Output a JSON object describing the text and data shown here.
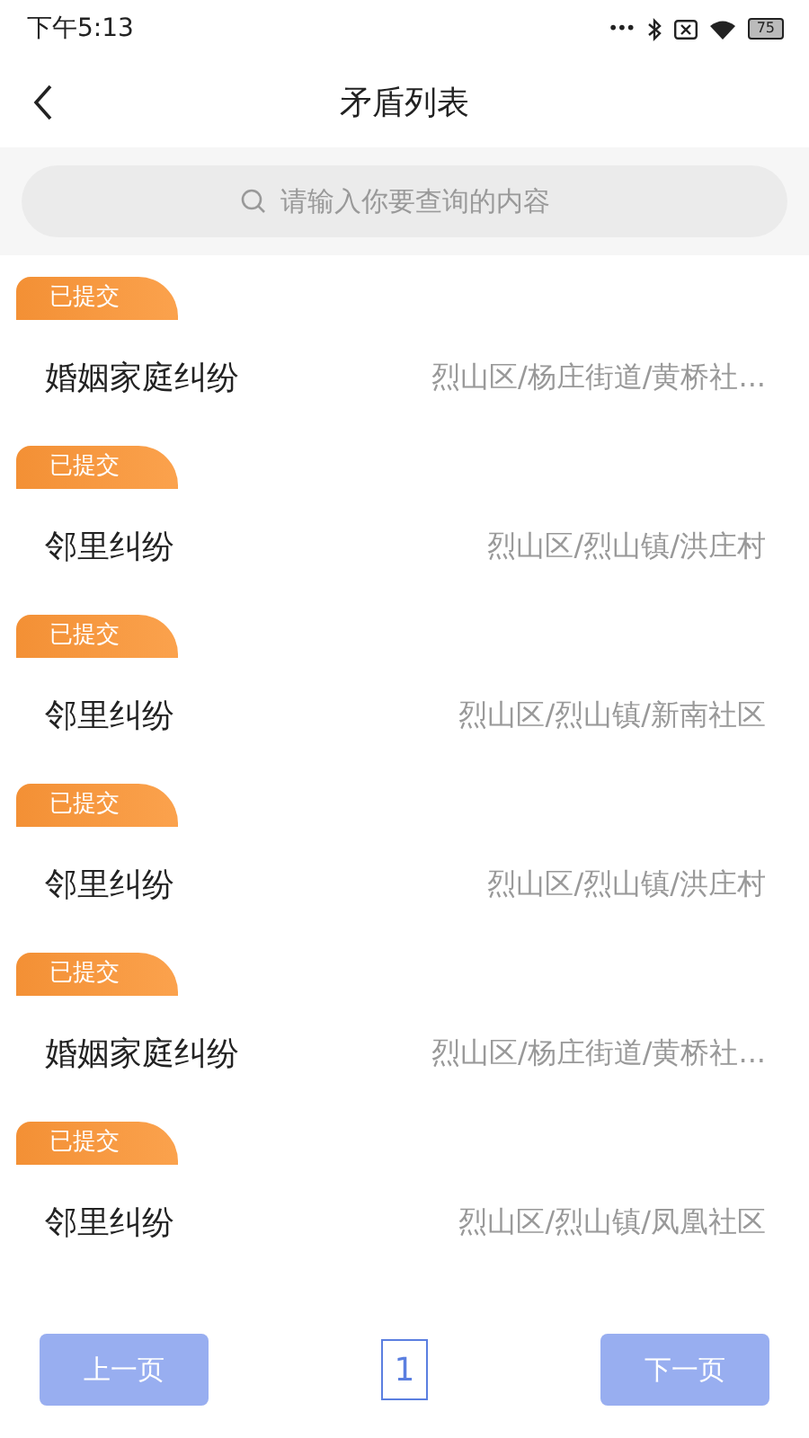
{
  "status_bar": {
    "time": "下午5:13",
    "dots": "•••",
    "battery": "75"
  },
  "header": {
    "title": "矛盾列表"
  },
  "search": {
    "placeholder": "请输入你要查询的内容"
  },
  "items": [
    {
      "status": "已提交",
      "title": "婚姻家庭纠纷",
      "location": "烈山区/杨庄街道/黄桥社..."
    },
    {
      "status": "已提交",
      "title": "邻里纠纷",
      "location": "烈山区/烈山镇/洪庄村"
    },
    {
      "status": "已提交",
      "title": "邻里纠纷",
      "location": "烈山区/烈山镇/新南社区"
    },
    {
      "status": "已提交",
      "title": "邻里纠纷",
      "location": "烈山区/烈山镇/洪庄村"
    },
    {
      "status": "已提交",
      "title": "婚姻家庭纠纷",
      "location": "烈山区/杨庄街道/黄桥社..."
    },
    {
      "status": "已提交",
      "title": "邻里纠纷",
      "location": "烈山区/烈山镇/凤凰社区"
    }
  ],
  "pagination": {
    "prev": {
      "label": "上一页",
      "disabled": true
    },
    "pages": [
      {
        "label": "1",
        "selected": true
      }
    ],
    "next": {
      "label": "下一页",
      "disabled": true
    }
  }
}
